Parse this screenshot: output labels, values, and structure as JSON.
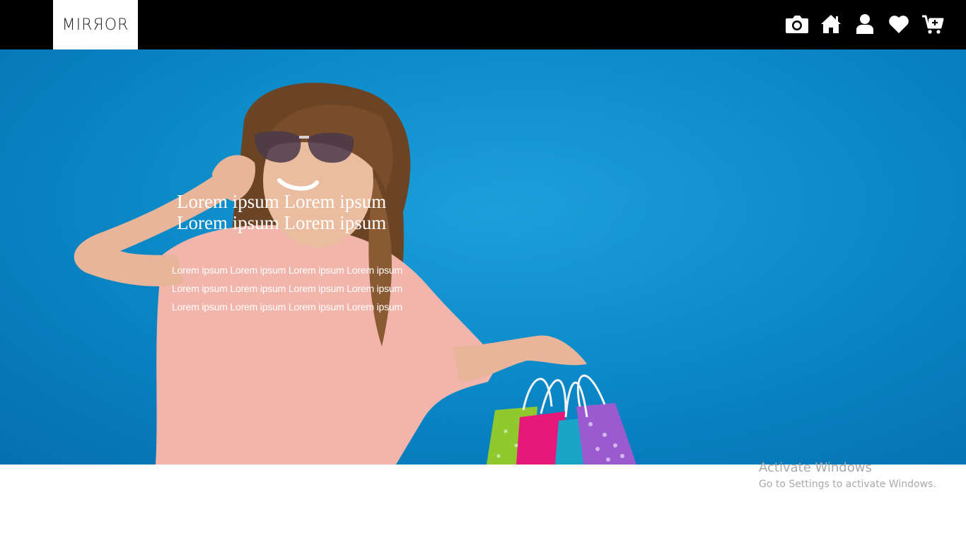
{
  "header": {
    "logo_text": "MIRЯOR",
    "icons": [
      "camera-icon",
      "home-icon",
      "user-icon",
      "heart-icon",
      "cart-plus-icon"
    ]
  },
  "hero": {
    "title_lines": [
      "Lorem ipsum Lorem ipsum",
      "Lorem ipsum Lorem ipsum"
    ],
    "body_lines": [
      "Lorem ipsum Lorem ipsum Lorem ipsum Lorem ipsum",
      "Lorem ipsum Lorem ipsum Lorem ipsum Lorem ipsum",
      "Lorem ipsum Lorem ipsum Lorem ipsum Lorem ipsum"
    ]
  },
  "watermark": {
    "title": "Activate Windows",
    "subtitle": "Go to Settings to activate Windows."
  },
  "colors": {
    "header_bg": "#000000",
    "hero_bg": "#0a88c7",
    "text": "#ffffff"
  }
}
